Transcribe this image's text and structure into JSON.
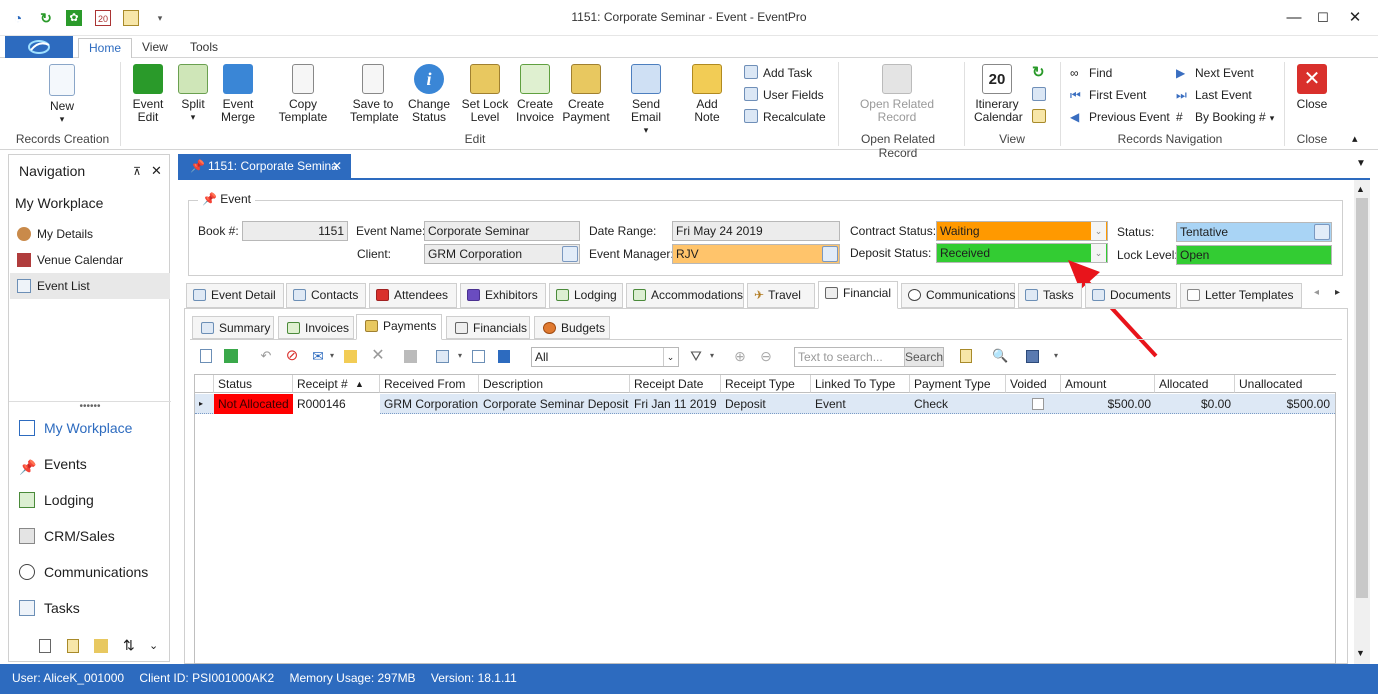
{
  "window": {
    "title": "1151: Corporate Seminar - Event - EventPro"
  },
  "ribbon_tabs": [
    "Home",
    "View",
    "Tools"
  ],
  "ribbon": {
    "new": "New",
    "records_creation": "Records Creation",
    "event_edit": [
      "Event",
      "Edit"
    ],
    "split": "Split",
    "event_merge": [
      "Event",
      "Merge"
    ],
    "copy_template": "Copy Template",
    "save_to_template": [
      "Save to",
      "Template"
    ],
    "change_status": [
      "Change",
      "Status"
    ],
    "set_lock_level": [
      "Set Lock",
      "Level"
    ],
    "create_invoice": [
      "Create",
      "Invoice"
    ],
    "create_payment": [
      "Create",
      "Payment"
    ],
    "send_email": "Send Email",
    "add_note": "Add Note",
    "add_task": "Add Task",
    "user_fields": "User Fields",
    "recalculate": "Recalculate",
    "edit_group": "Edit",
    "open_related_record": [
      "Open Related",
      "Record"
    ],
    "open_related_group": "Open Related Record",
    "itinerary_calendar": [
      "Itinerary",
      "Calendar"
    ],
    "view_group": "View",
    "find": "Find",
    "first_event": "First Event",
    "previous_event": "Previous Event",
    "next_event": "Next Event",
    "last_event": "Last Event",
    "by_booking": "By Booking #",
    "records_navigation": "Records Navigation",
    "close": "Close",
    "close_group": "Close"
  },
  "navigation": {
    "title": "Navigation",
    "workplace": "My Workplace",
    "items": [
      "My Details",
      "Venue Calendar",
      "Event List"
    ],
    "sections": [
      "My Workplace",
      "Events",
      "Lodging",
      "CRM/Sales",
      "Communications",
      "Tasks"
    ]
  },
  "doc_tab": "1151: Corporate Semina",
  "event": {
    "group_title": "Event",
    "book_label": "Book #:",
    "book_value": "1151",
    "event_name_label": "Event Name:",
    "event_name_value": "Corporate Seminar",
    "client_label": "Client:",
    "client_value": "GRM Corporation",
    "date_range_label": "Date Range:",
    "date_range_value": "Fri May 24 2019",
    "event_manager_label": "Event Manager:",
    "event_manager_value": "RJV",
    "contract_status_label": "Contract Status:",
    "contract_status_value": "Waiting",
    "deposit_status_label": "Deposit Status:",
    "deposit_status_value": "Received",
    "status_label": "Status:",
    "status_value": "Tentative",
    "lock_level_label": "Lock Level:",
    "lock_level_value": "Open"
  },
  "main_tabs": [
    "Event Detail",
    "Contacts",
    "Attendees",
    "Exhibitors",
    "Lodging",
    "Accommodations",
    "Travel",
    "Financial",
    "Communications",
    "Tasks",
    "Documents",
    "Letter Templates"
  ],
  "sub_tabs": [
    "Summary",
    "Invoices",
    "Payments",
    "Financials",
    "Budgets"
  ],
  "toolbar": {
    "filter_value": "All",
    "search_placeholder": "Text to search...",
    "search_button": "Search"
  },
  "grid": {
    "columns": [
      "Status",
      "Receipt #",
      "Received From",
      "Description",
      "Receipt Date",
      "Receipt Type",
      "Linked To Type",
      "Payment Type",
      "Voided",
      "Amount",
      "Allocated",
      "Unallocated"
    ],
    "rows": [
      [
        "Not Allocated",
        "R000146",
        "GRM Corporation",
        "Corporate Seminar Deposit",
        "Fri Jan 11 2019",
        "Deposit",
        "Event",
        "Check",
        "",
        "$500.00",
        "$0.00",
        "$500.00"
      ]
    ]
  },
  "statusbar": {
    "user": "User: AliceK_001000",
    "client_id": "Client ID: PSI001000AK2",
    "memory": "Memory Usage: 297MB",
    "version": "Version: 18.1.11"
  },
  "colors": {
    "accent": "#2d6bbf",
    "waiting": "#ff9900",
    "received": "#33cc33",
    "tentative": "#a9d4f5",
    "open": "#33cc33",
    "not_allocated": "#ff0000",
    "manager": "#ffc46b",
    "arrow": "#e8141b"
  }
}
